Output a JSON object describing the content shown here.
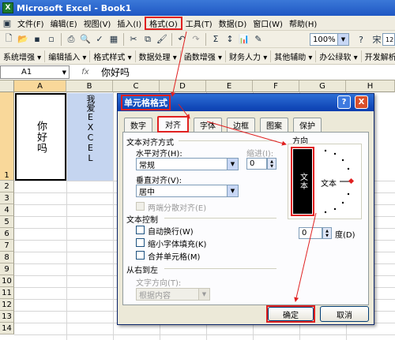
{
  "window": {
    "title": "Microsoft Excel - Book1",
    "app_icon": "X"
  },
  "menu": [
    "文件(F)",
    "编辑(E)",
    "视图(V)",
    "插入(I)",
    "格式(O)",
    "工具(T)",
    "数据(D)",
    "窗口(W)",
    "帮助(H)"
  ],
  "toolbar": {
    "zoom": "100%",
    "font_size": "12"
  },
  "addin_toolbar": [
    "系统增强 ▾",
    "编辑插入 ▾",
    "格式样式 ▾",
    "数据处理 ▾",
    "函数增强 ▾",
    "财务人力 ▾",
    "其他辅助 ▾",
    "办公绿软 ▾",
    "开发解析"
  ],
  "formula_bar": {
    "name_box": "A1",
    "fx": "fx",
    "content": "你好吗"
  },
  "sheet": {
    "columns": [
      "A",
      "B",
      "C",
      "D",
      "E",
      "F",
      "G",
      "H"
    ],
    "rows": [
      "1",
      "2",
      "3",
      "4",
      "5",
      "6",
      "7",
      "8",
      "9",
      "10",
      "11",
      "12",
      "13",
      "14"
    ],
    "cell_a1": "你好吗",
    "cell_b1": "我爱EXCEL"
  },
  "dialog": {
    "title": "单元格格式",
    "help": "?",
    "close": "X",
    "tabs": [
      "数字",
      "对齐",
      "字体",
      "边框",
      "图案",
      "保护"
    ],
    "active_tab": "对齐",
    "text_align_section": "文本对齐方式",
    "horizontal_label": "水平对齐(H):",
    "horizontal_value": "常规",
    "indent_label": "缩进(I):",
    "indent_value": "0",
    "vertical_label": "垂直对齐(V):",
    "vertical_value": "居中",
    "justify_distributed": "两端分散对齐(E)",
    "text_control_section": "文本控制",
    "wrap_text": "自动换行(W)",
    "shrink_to_fit": "缩小字体填充(K)",
    "merge_cells": "合并单元格(M)",
    "rtl_section": "从右到左",
    "text_direction_label": "文字方向(T):",
    "text_direction_value": "根据内容",
    "orientation_section": "方向",
    "vertical_text": "文本",
    "rotated_text": "文本",
    "degree_value": "0",
    "degree_label": "度(D)",
    "ok": "确定",
    "cancel": "取消"
  },
  "colors": {
    "highlight": "#e02020",
    "selection": "#c5d5f0"
  }
}
